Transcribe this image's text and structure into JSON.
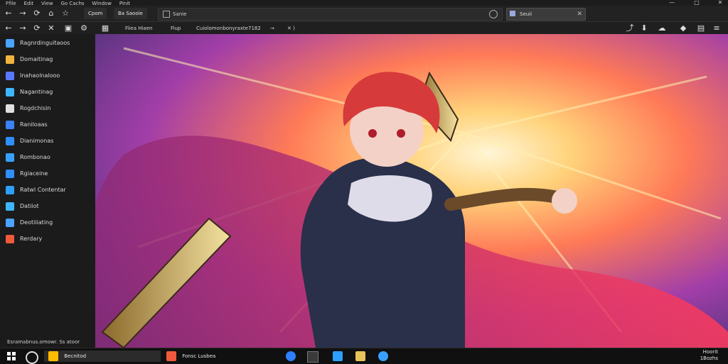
{
  "menubar": [
    "Ffile",
    "Edit",
    "View",
    "Go Cachs",
    "Window",
    "Pinit"
  ],
  "window_controls": [
    "—",
    "□",
    "✕"
  ],
  "toolbar": {
    "tabs": [
      "Cpom",
      "Ba Saooie"
    ],
    "address_text": "Sanie",
    "search_placeholder": "Seuii"
  },
  "toolbar2": {
    "items": [
      "Fiiea Hiaen",
      "Fiup",
      "Cuiolomonbonyraxte7182",
      "→",
      "✕ )"
    ]
  },
  "sidebar": {
    "items": [
      {
        "label": "Ragnrdinguitaoos",
        "icon": "doc-icon",
        "color": "#4aa3ff"
      },
      {
        "label": "Domaitinag",
        "icon": "app-icon",
        "color": "#f0b43c"
      },
      {
        "label": "Inahaolnalooo",
        "icon": "folder-icon",
        "color": "#5a78ff"
      },
      {
        "label": "Nagantinag",
        "icon": "chart-icon",
        "color": "#3db6ff"
      },
      {
        "label": "Rogdchisin",
        "icon": "file-icon",
        "color": "#e0e0e0"
      },
      {
        "label": "Raniloaas",
        "icon": "tile-icon",
        "color": "#3b82f6"
      },
      {
        "label": "Dianimonas",
        "icon": "box-icon",
        "color": "#2f8fff"
      },
      {
        "label": "Rombonao",
        "icon": "edge-icon",
        "color": "#38a1ff"
      },
      {
        "label": "Rgiaceine",
        "icon": "graph-icon",
        "color": "#2f8fff"
      },
      {
        "label": "Ratwl Contentar",
        "icon": "box-icon",
        "color": "#2da0ff"
      },
      {
        "label": "Datiiot",
        "icon": "pin-icon",
        "color": "#3db6ff"
      },
      {
        "label": "Deotiiiating",
        "icon": "doc-icon",
        "color": "#4aa3ff"
      },
      {
        "label": "Rerdary",
        "icon": "tile-icon",
        "color": "#f05a3c"
      }
    ]
  },
  "status_text": "Esramabnus.omowr. Ss atoor",
  "taskbar": {
    "items": [
      {
        "label": "Becnitod",
        "color": "#ffbb00"
      },
      {
        "label": "Fonsc Lusbea",
        "color": "#f05a3c"
      }
    ],
    "clock": [
      "Hoorit",
      "1Bozhs"
    ]
  }
}
